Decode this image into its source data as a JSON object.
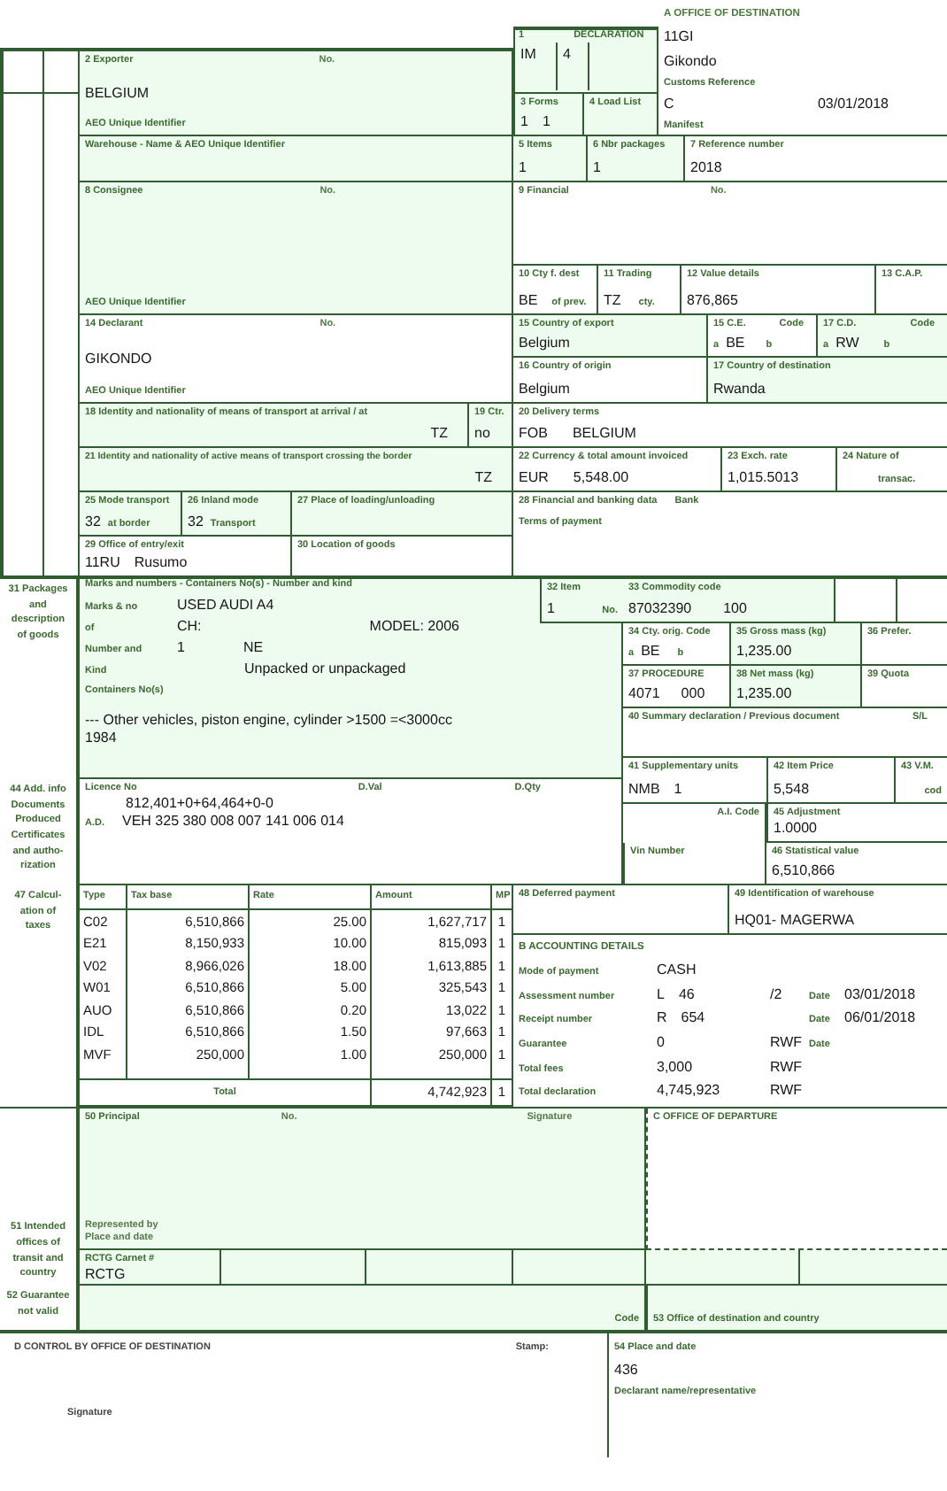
{
  "office_of_destination": {
    "title": "A OFFICE OF DESTINATION",
    "code": "11GI",
    "name": "Gikondo",
    "reference_label": "Customs Reference",
    "reference": "C",
    "date": "03/01/2018",
    "manifest_label": "Manifest"
  },
  "declaration": {
    "number": "1",
    "title": "DECLARATION",
    "type": "IM",
    "subtype": "4"
  },
  "exporter": {
    "label": "2 Exporter",
    "no_label": "No.",
    "address": "BELGIUM",
    "aeo_label": "AEO Unique Identifier"
  },
  "forms": {
    "label": "3 Forms",
    "values": [
      "1",
      "1"
    ]
  },
  "load_list": {
    "label": "4 Load List"
  },
  "warehouse": {
    "label": "Warehouse - Name & AEO Unique Identifier"
  },
  "items": {
    "label": "5 Items",
    "value": "1"
  },
  "packages": {
    "label": "6 Nbr packages",
    "value": "1"
  },
  "reference_number": {
    "label": "7 Reference number",
    "value": "2018"
  },
  "consignee": {
    "label": "8 Consignee",
    "no_label": "No.",
    "aeo_label": "AEO Unique Identifier"
  },
  "financial": {
    "label": "9 Financial",
    "no_label": "No."
  },
  "country_first_dest": {
    "label": "10 Cty f. dest",
    "value": "BE",
    "suffix": "of prev."
  },
  "trading": {
    "label": "11 Trading",
    "value": "TZ",
    "suffix": "cty."
  },
  "value_details": {
    "label": "12 Value details",
    "value": "876,865"
  },
  "cap": {
    "label": "13 C.A.P."
  },
  "declarant": {
    "label": "14 Declarant",
    "no_label": "No.",
    "address": "GIKONDO",
    "aeo_label": "AEO Unique Identifier"
  },
  "country_export": {
    "label": "15 Country of export",
    "value": "Belgium"
  },
  "ce": {
    "label": "15 C.E.",
    "code_label": "Code",
    "a": "a",
    "value": "BE",
    "b": "b"
  },
  "cd": {
    "label": "17 C.D.",
    "code_label": "Code",
    "a": "a",
    "value": "RW",
    "b": "b"
  },
  "country_origin": {
    "label": "16 Country of origin",
    "value": "Belgium"
  },
  "country_destination": {
    "label": "17 Country of destination",
    "value": "Rwanda"
  },
  "transport_arrival": {
    "label": "18 Identity and nationality of means of transport at arrival / at",
    "nationality": "TZ"
  },
  "container": {
    "label": "19 Ctr.",
    "value": "no"
  },
  "delivery_terms": {
    "label": "20 Delivery terms",
    "code": "FOB",
    "place": "BELGIUM"
  },
  "transport_border": {
    "label": "21 Identity and nationality of active means of transport crossing the border",
    "nationality": "TZ"
  },
  "currency": {
    "label": "22 Currency & total amount invoiced",
    "currency": "EUR",
    "amount": "5,548.00"
  },
  "exchange_rate": {
    "label": "23 Exch. rate",
    "value": "1,015.5013"
  },
  "nature": {
    "label": "24 Nature of",
    "suffix": "transac."
  },
  "mode_border": {
    "label": "25 Mode transport",
    "value": "32",
    "suffix": "at border"
  },
  "inland_mode": {
    "label": "26 Inland mode",
    "value": "32",
    "suffix": "Transport"
  },
  "loading_place": {
    "label": "27 Place of loading/unloading"
  },
  "banking": {
    "label": "28 Financial and banking data",
    "bank_label": "Bank",
    "terms_label": "Terms of payment"
  },
  "office_entry": {
    "label": "29 Office of entry/exit",
    "code": "11RU",
    "name": "Rusumo"
  },
  "goods_location": {
    "label": "30 Location of goods"
  },
  "goods": {
    "side_label": "31 Packages\nand\ndescription\nof goods",
    "title": "Marks and numbers - Containers No(s) - Number and kind",
    "marks_label": "Marks & no",
    "marks": "USED AUDI A4",
    "of_label": "of",
    "chassis": "CH:",
    "model": "MODEL: 2006",
    "number_label": "Number and",
    "kind_label": "Kind",
    "number": "1",
    "package_code": "NE",
    "package_kind": "Unpacked or unpackaged",
    "containers_label": "Containers No(s)",
    "description": "--- Other vehicles, piston engine, cylinder >1500 =<3000cc",
    "year": "1984"
  },
  "item": {
    "label": "32 Item",
    "value": "1",
    "no_label": "No."
  },
  "commodity_code": {
    "label": "33 Commodity code",
    "code": "87032390",
    "suffix": "100"
  },
  "origin_code": {
    "label": "34 Cty. orig. Code",
    "a": "a",
    "value": "BE",
    "b": "b"
  },
  "gross_mass": {
    "label": "35 Gross mass (kg)",
    "value": "1,235.00"
  },
  "preference": {
    "label": "36 Prefer."
  },
  "procedure": {
    "label": "37 PROCEDURE",
    "code": "4071",
    "extra": "000"
  },
  "net_mass": {
    "label": "38 Net mass (kg)",
    "value": "1,235.00"
  },
  "quota": {
    "label": "39 Quota"
  },
  "summary_declaration": {
    "label": "40 Summary declaration / Previous document",
    "sl_label": "S/L"
  },
  "supplementary_units": {
    "label": "41 Supplementary units",
    "unit": "NMB",
    "value": "1"
  },
  "item_price": {
    "label": "42 Item Price",
    "value": "5,548"
  },
  "valuation_method": {
    "label": "43 V.M.",
    "code_label": "cod"
  },
  "additional_info": {
    "side_label": "44 Add. info\nDocuments\nProduced\nCertificates\nand autho-\nrization",
    "licence_label": "Licence No",
    "dval_label": "D.Val",
    "dqty_label": "D.Qty",
    "values": "812,401+0+64,464+0-0",
    "ad_label": "A.D.",
    "ad_value": "VEH 325 380 008 007 141 006 014"
  },
  "ai_code": {
    "label": "A.I. Code"
  },
  "adjustment": {
    "label": "45 Adjustment",
    "value": "1.0000"
  },
  "vin": {
    "label": "Vin Number"
  },
  "statistical_value": {
    "label": "46 Statistical value",
    "value": "6,510,866"
  },
  "taxes": {
    "side_label": "47 Calcul-\nation of\ntaxes",
    "columns": [
      "Type",
      "Tax base",
      "Rate",
      "Amount",
      "MP"
    ],
    "rows": [
      {
        "type": "C02",
        "base": "6,510,866",
        "rate": "25.00",
        "amount": "1,627,717",
        "mp": "1"
      },
      {
        "type": "E21",
        "base": "8,150,933",
        "rate": "10.00",
        "amount": "815,093",
        "mp": "1"
      },
      {
        "type": "V02",
        "base": "8,966,026",
        "rate": "18.00",
        "amount": "1,613,885",
        "mp": "1"
      },
      {
        "type": "W01",
        "base": "6,510,866",
        "rate": "5.00",
        "amount": "325,543",
        "mp": "1"
      },
      {
        "type": "AUO",
        "base": "6,510,866",
        "rate": "0.20",
        "amount": "13,022",
        "mp": "1"
      },
      {
        "type": "IDL",
        "base": "6,510,866",
        "rate": "1.50",
        "amount": "97,663",
        "mp": "1"
      },
      {
        "type": "MVF",
        "base": "250,000",
        "rate": "1.00",
        "amount": "250,000",
        "mp": "1"
      }
    ],
    "total_label": "Total",
    "total": "4,742,923",
    "total_mp": "1"
  },
  "deferred_payment": {
    "label": "48 Deferred payment"
  },
  "warehouse_id": {
    "label": "49 Identification of warehouse",
    "value": "HQ01- MAGERWA"
  },
  "accounting": {
    "title": "B ACCOUNTING DETAILS",
    "rows": [
      {
        "label": "Mode of payment",
        "value": "CASH"
      },
      {
        "label": "Assessment number",
        "series": "L",
        "value": "46",
        "suffix": "/2",
        "date_label": "Date",
        "date": "03/01/2018"
      },
      {
        "label": "Receipt number",
        "series": "R",
        "value": "654",
        "date_label": "Date",
        "date": "06/01/2018"
      },
      {
        "label": "Guarantee",
        "value": "0",
        "currency": "RWF",
        "date_label": "Date"
      },
      {
        "label": "Total fees",
        "value": "3,000",
        "currency": "RWF"
      },
      {
        "label": "Total declaration",
        "value": "4,745,923",
        "currency": "RWF"
      }
    ]
  },
  "principal": {
    "label": "50 Principal",
    "no_label": "No.",
    "signature_label": "Signature",
    "represented_label": "Represented by\nPlace and date"
  },
  "office_departure": {
    "title": "C OFFICE OF DEPARTURE"
  },
  "transit": {
    "side_label": "51 Intended\noffices of\ntransit and\ncountry",
    "carnet_label": "RCTG Carnet #",
    "carnet": "RCTG"
  },
  "guarantee": {
    "side_label": "52 Guarantee\nnot valid",
    "code_label": "Code",
    "destination_label": "53 Office of destination and country"
  },
  "control": {
    "title": "D CONTROL BY OFFICE OF DESTINATION",
    "stamp_label": "Stamp:",
    "signature_label": "Signature"
  },
  "place_date": {
    "label": "54 Place and date",
    "value": "436",
    "declarant_label": "Declarant name/representative"
  }
}
